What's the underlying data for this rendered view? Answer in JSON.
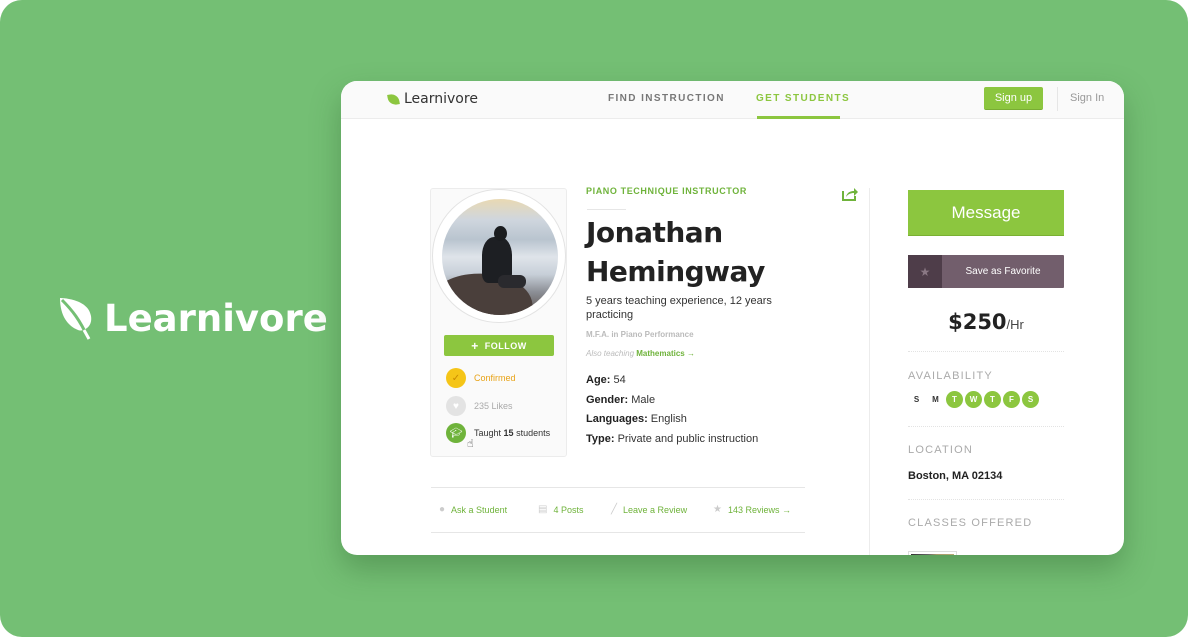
{
  "brand": {
    "name": "Learnivore",
    "icon": "leaf-icon"
  },
  "nav": {
    "logo": "Learnivore",
    "links": [
      {
        "label": "FIND INSTRUCTION",
        "active": false
      },
      {
        "label": "GET STUDENTS",
        "active": true
      }
    ],
    "signup_label": "Sign up",
    "signin_label": "Sign In"
  },
  "profile": {
    "follow_label": "FOLLOW",
    "stats": {
      "confirmed": "Confirmed",
      "likes": "235 Likes",
      "taught_prefix": "Taught",
      "taught_count": "15",
      "taught_suffix": "students"
    },
    "role": "PIANO TECHNIQUE INSTRUCTOR",
    "first_name": "Jonathan",
    "last_name": "Hemingway",
    "experience": "5 years teaching experience, 12 years practicing",
    "degree": "M.F.A. in Piano Performance",
    "also_teaching_label": "Also teaching",
    "also_teaching_subject": "Mathematics →",
    "facts": [
      {
        "label": "Age:",
        "value": "54"
      },
      {
        "label": "Gender:",
        "value": "Male"
      },
      {
        "label": "Languages:",
        "value": "English"
      },
      {
        "label": "Type:",
        "value": "Private and public instruction"
      }
    ],
    "actions": [
      {
        "label": "Ask a Student",
        "icon": "speech-bubble-icon"
      },
      {
        "label": "4 Posts",
        "icon": "document-icon"
      },
      {
        "label": "Leave a Review",
        "icon": "pencil-icon"
      },
      {
        "label": "143 Reviews →",
        "icon": "star-icon"
      }
    ]
  },
  "sidebar": {
    "message_label": "Message",
    "favorite_label": "Save as Favorite",
    "price": "$250",
    "price_unit": "/Hr",
    "availability_label": "AVAILABILITY",
    "days": [
      {
        "d": "S",
        "available": false
      },
      {
        "d": "M",
        "available": false
      },
      {
        "d": "T",
        "available": true
      },
      {
        "d": "W",
        "available": true
      },
      {
        "d": "T",
        "available": true
      },
      {
        "d": "F",
        "available": true
      },
      {
        "d": "S",
        "available": true
      }
    ],
    "location_label": "LOCATION",
    "location": "Boston, MA 02134",
    "classes_label": "CLASSES OFFERED"
  },
  "colors": {
    "background": "#74bf74",
    "accent": "#8cc63f",
    "accent_text": "#6fb33b",
    "favorite": "#725e6c",
    "confirmed": "#e8a317"
  }
}
